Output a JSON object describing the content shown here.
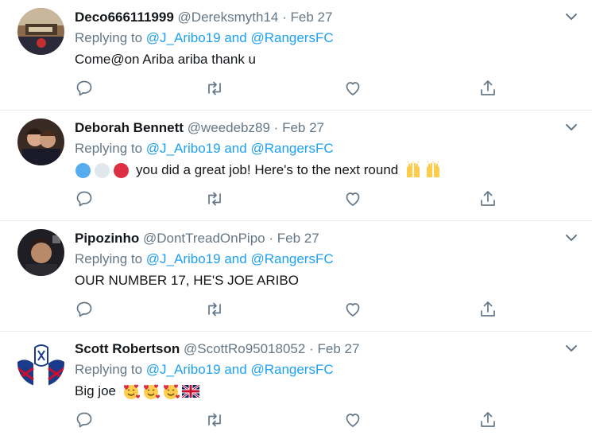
{
  "tweets": [
    {
      "name": "Deco666111999",
      "handle": "@Dereksmyth14",
      "separator": "·",
      "date": "Feb 27",
      "replying_prefix": "Replying to",
      "replying_user1": "@J_Aribo19",
      "replying_and": "and",
      "replying_user2": "@RangersFC",
      "text": "Come@on Ariba ariba thank u",
      "avatar_icon": "avatar-photo"
    },
    {
      "name": "Deborah Bennett",
      "handle": "@weedebz89",
      "separator": "·",
      "date": "Feb 27",
      "replying_prefix": "Replying to",
      "replying_user1": "@J_Aribo19",
      "replying_and": "and",
      "replying_user2": "@RangersFC",
      "text": "you did a great job! Here's to the next round",
      "emoji_before": [
        "blue-circle",
        "white-circle",
        "red-circle"
      ],
      "emoji_after": [
        "raising-hands",
        "raising-hands"
      ],
      "avatar_icon": "avatar-photo"
    },
    {
      "name": "Pipozinho",
      "handle": "@DontTreadOnPipo",
      "separator": "·",
      "date": "Feb 27",
      "replying_prefix": "Replying to",
      "replying_user1": "@J_Aribo19",
      "replying_and": "and",
      "replying_user2": "@RangersFC",
      "text": "OUR NUMBER 17, HE'S JOE ARIBO",
      "avatar_icon": "avatar-photo"
    },
    {
      "name": "Scott Robertson",
      "handle": "@ScottRo95018052",
      "separator": "·",
      "date": "Feb 27",
      "replying_prefix": "Replying to",
      "replying_user1": "@J_Aribo19",
      "replying_and": "and",
      "replying_user2": "@RangersFC",
      "text": "Big joe",
      "emoji_after": [
        "smiling-face-with-hearts",
        "smiling-face-with-hearts",
        "smiling-face-with-hearts",
        "union-jack-flag"
      ],
      "avatar_icon": "rangers-crest-avatar"
    }
  ],
  "colors": {
    "link": "#1da1f2",
    "muted": "#657786",
    "text": "#14171a",
    "divider": "#e6ecf0"
  }
}
